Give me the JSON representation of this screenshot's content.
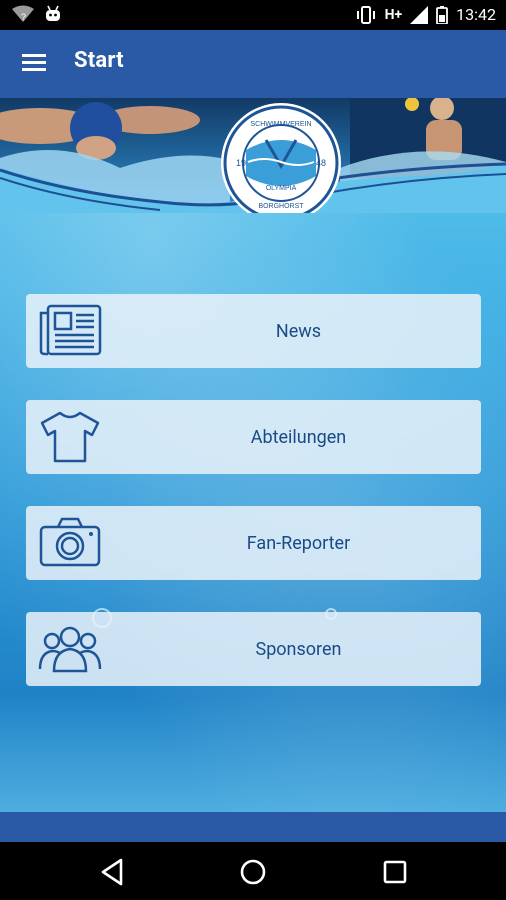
{
  "status_bar": {
    "time": "13:42",
    "network": "H+"
  },
  "app_bar": {
    "title": "Start",
    "menu_icon": "hamburger-menu-icon"
  },
  "header_logo": {
    "text_top": "SCHWIMMVEREIN",
    "text_middle": "OLYMPIA",
    "text_bottom": "BORGHORST",
    "year_left": "19",
    "year_right": "48"
  },
  "menu": {
    "items": [
      {
        "label": "News",
        "icon": "newspaper-icon"
      },
      {
        "label": "Abteilungen",
        "icon": "tshirt-icon"
      },
      {
        "label": "Fan-Reporter",
        "icon": "camera-icon"
      },
      {
        "label": "Sponsoren",
        "icon": "people-group-icon"
      }
    ]
  },
  "colors": {
    "app_bar": "#2a5aa6",
    "card_text": "#1b4b86",
    "icon_stroke": "#1f5596"
  },
  "nav_bar": {
    "back_icon": "back-triangle-icon",
    "home_icon": "home-circle-icon",
    "recents_icon": "recents-square-icon"
  }
}
